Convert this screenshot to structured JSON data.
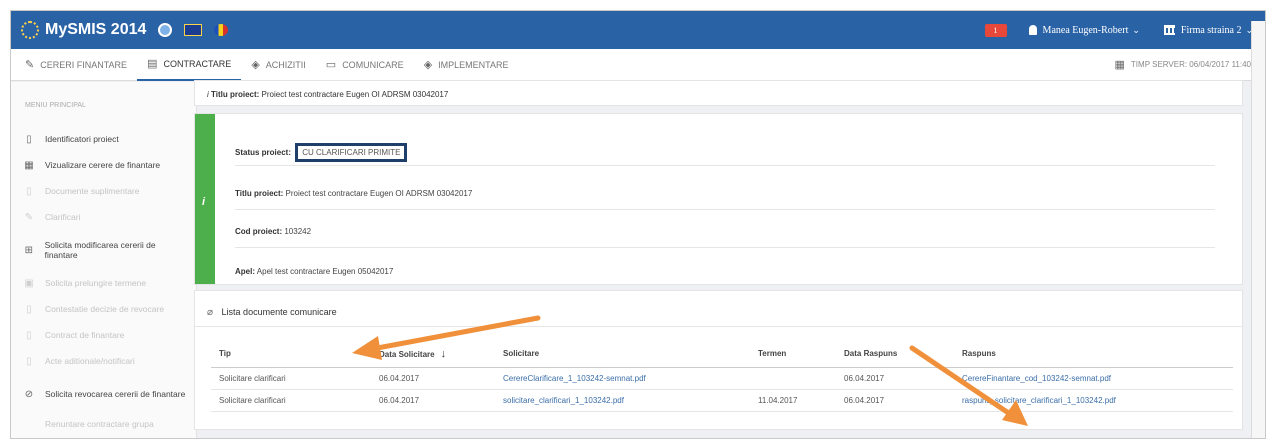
{
  "topbar": {
    "app_title": "MySMIS 2014",
    "notifications_count": "1",
    "user_name": "Manea Eugen-Robert",
    "org_name": "Firma straina 2",
    "colors": {
      "bar": "#2a62a6",
      "badge": "#e8483a"
    }
  },
  "nav": {
    "items": [
      {
        "label": "CERERI FINANTARE",
        "icon": "pencil-icon"
      },
      {
        "label": "CONTRACTARE",
        "icon": "document-icon"
      },
      {
        "label": "ACHIZITII",
        "icon": "layers-icon"
      },
      {
        "label": "COMUNICARE",
        "icon": "monitor-icon"
      },
      {
        "label": "IMPLEMENTARE",
        "icon": "layers-icon"
      }
    ],
    "active": "CONTRACTARE",
    "server_time": "TIMP SERVER: 06/04/2017 11:40"
  },
  "sidebar": {
    "heading": "MENIU PRINCIPAL",
    "items": [
      {
        "label": "Identificatori proiect",
        "icon": "document-icon",
        "enabled": true
      },
      {
        "label": "Vizualizare cerere de finantare",
        "icon": "table-icon",
        "enabled": true
      },
      {
        "label": "Documente suplimentare",
        "icon": "document-icon",
        "enabled": false
      },
      {
        "label": "Clarificari",
        "icon": "pencil-icon",
        "enabled": false
      },
      {
        "label": "Solicita modificarea cererii de finantare",
        "icon": "document-plus-icon",
        "enabled": true
      },
      {
        "label": "Solicita prelungire termene",
        "icon": "calendar-icon",
        "enabled": false
      },
      {
        "label": "Contestatie decizie de revocare",
        "icon": "document-icon",
        "enabled": false
      },
      {
        "label": "Contract de finantare",
        "icon": "document-icon",
        "enabled": false
      },
      {
        "label": "Acte aditionale/notificari",
        "icon": "document-icon",
        "enabled": false
      },
      {
        "label": "Solicita revocarea cererii de finantare",
        "icon": "ban-icon",
        "enabled": true
      },
      {
        "label": "Renuntare contractare grupa",
        "icon": "document-icon",
        "enabled": false
      }
    ]
  },
  "project": {
    "title_label": "Titlu proiect:",
    "title_value": "Proiect test contractare Eugen OI ADRSM 03042017",
    "status_label": "Status proiect:",
    "status_value": "CU CLARIFICARI PRIMITE",
    "code_label": "Cod proiect:",
    "code_value": "103242",
    "call_label": "Apel:",
    "call_value": "Apel test contractare Eugen 05042017"
  },
  "documents": {
    "heading": "Lista documente comunicare",
    "columns": [
      "Tip",
      "Data Solicitare",
      "Solicitare",
      "Termen",
      "Data Raspuns",
      "Raspuns"
    ],
    "rows": [
      {
        "tip": "Solicitare clarificari",
        "data_solicitare": "06.04.2017",
        "solicitare": "CerereClarificare_1_103242-semnat.pdf",
        "termen": "",
        "data_raspuns": "06.04.2017",
        "raspuns": "CerereFinantare_cod_103242-semnat.pdf"
      },
      {
        "tip": "Solicitare clarificari",
        "data_solicitare": "06.04.2017",
        "solicitare": "solicitare_clarificari_1_103242.pdf",
        "termen": "11.04.2017",
        "data_raspuns": "06.04.2017",
        "raspuns": "raspuns_solicitare_clarificari_1_103242.pdf"
      }
    ]
  },
  "annotations": {
    "arrow_color": "#f0903a"
  }
}
